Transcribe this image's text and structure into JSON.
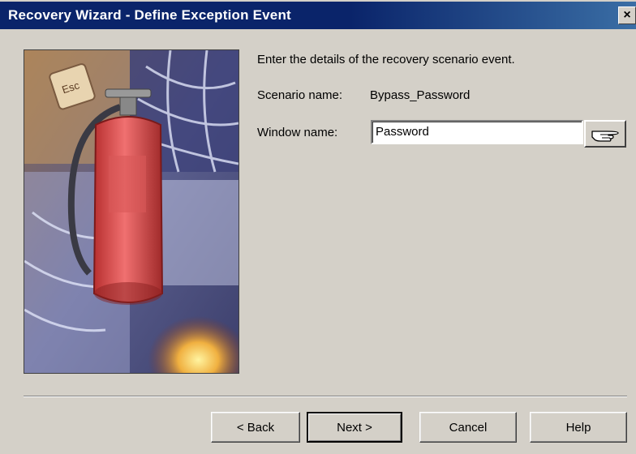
{
  "window": {
    "title": "Recovery Wizard - Define Exception Event",
    "close_glyph": "×"
  },
  "content": {
    "intro": "Enter the details of the recovery scenario event.",
    "scenario_label": "Scenario name:",
    "scenario_value": "Bypass_Password",
    "window_label": "Window name:",
    "window_value": "Password"
  },
  "icons": {
    "pointer": "pointing-hand-icon",
    "picture": "fire-extinguisher-illustration"
  },
  "buttons": {
    "back": "< Back",
    "next": "Next >",
    "cancel": "Cancel",
    "help": "Help"
  },
  "colors": {
    "titlebar_start": "#0a246a",
    "titlebar_end": "#3a6ea5",
    "dialog_face": "#d4d0c8"
  }
}
